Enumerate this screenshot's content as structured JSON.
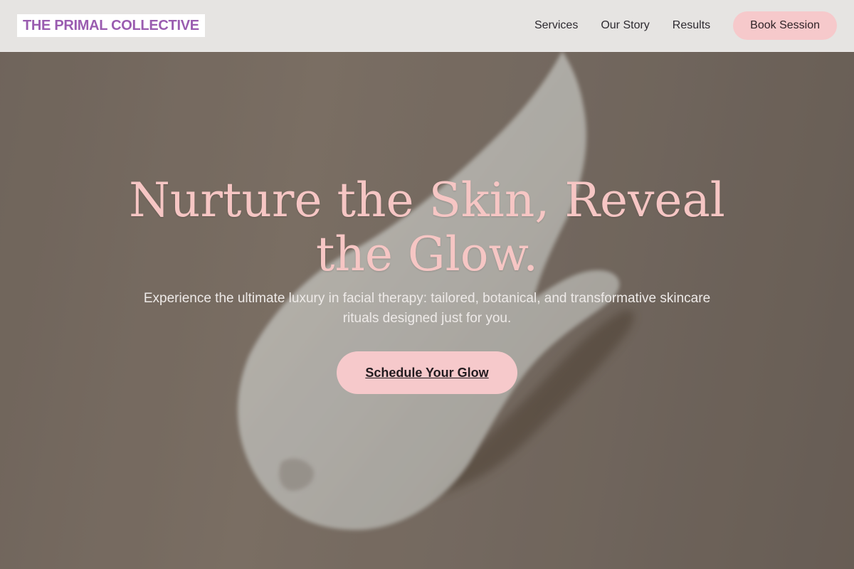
{
  "header": {
    "logo": "THE PRIMAL COLLECTIVE",
    "nav": [
      {
        "label": "Services"
      },
      {
        "label": "Our Story"
      },
      {
        "label": "Results"
      }
    ],
    "book_label": "Book Session"
  },
  "hero": {
    "headline": "Nurture the Skin, Reveal the Glow.",
    "subtitle": "Experience the ultimate luxury in facial therapy: tailored, botanical, and transformative skincare rituals designed just for you.",
    "cta_label": "Schedule Your Glow",
    "background_image": "cream-swatch-photo"
  },
  "colors": {
    "accent_pink": "#f6c9cb",
    "headline_pink": "#f6c6c4",
    "logo_purple": "#9a5cb0",
    "header_bg": "#e6e4e2"
  }
}
